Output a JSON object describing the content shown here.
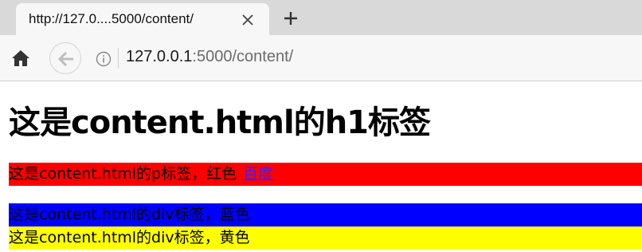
{
  "browser": {
    "tab_title": "http://127.0....5000/content/",
    "url_host": "127.0.0.1",
    "url_rest": ":5000/content/"
  },
  "page": {
    "heading": "这是content.html的h1标签",
    "p_text": "这是content.html的p标签，红色",
    "p_link": "百度",
    "div_blue_text": "这是content.html的div标签，蓝色",
    "div_yellow_text": "这是content.html的div标签，黄色"
  },
  "colors": {
    "red_bg": "#ff0000",
    "blue_bg": "#0000ff",
    "yellow_bg": "#ffff00",
    "link": "#3c1fff"
  },
  "icons": {
    "home": "home-icon",
    "back": "back-arrow-icon",
    "info": "info-icon",
    "close_tab": "close-icon",
    "new_tab": "plus-icon"
  }
}
